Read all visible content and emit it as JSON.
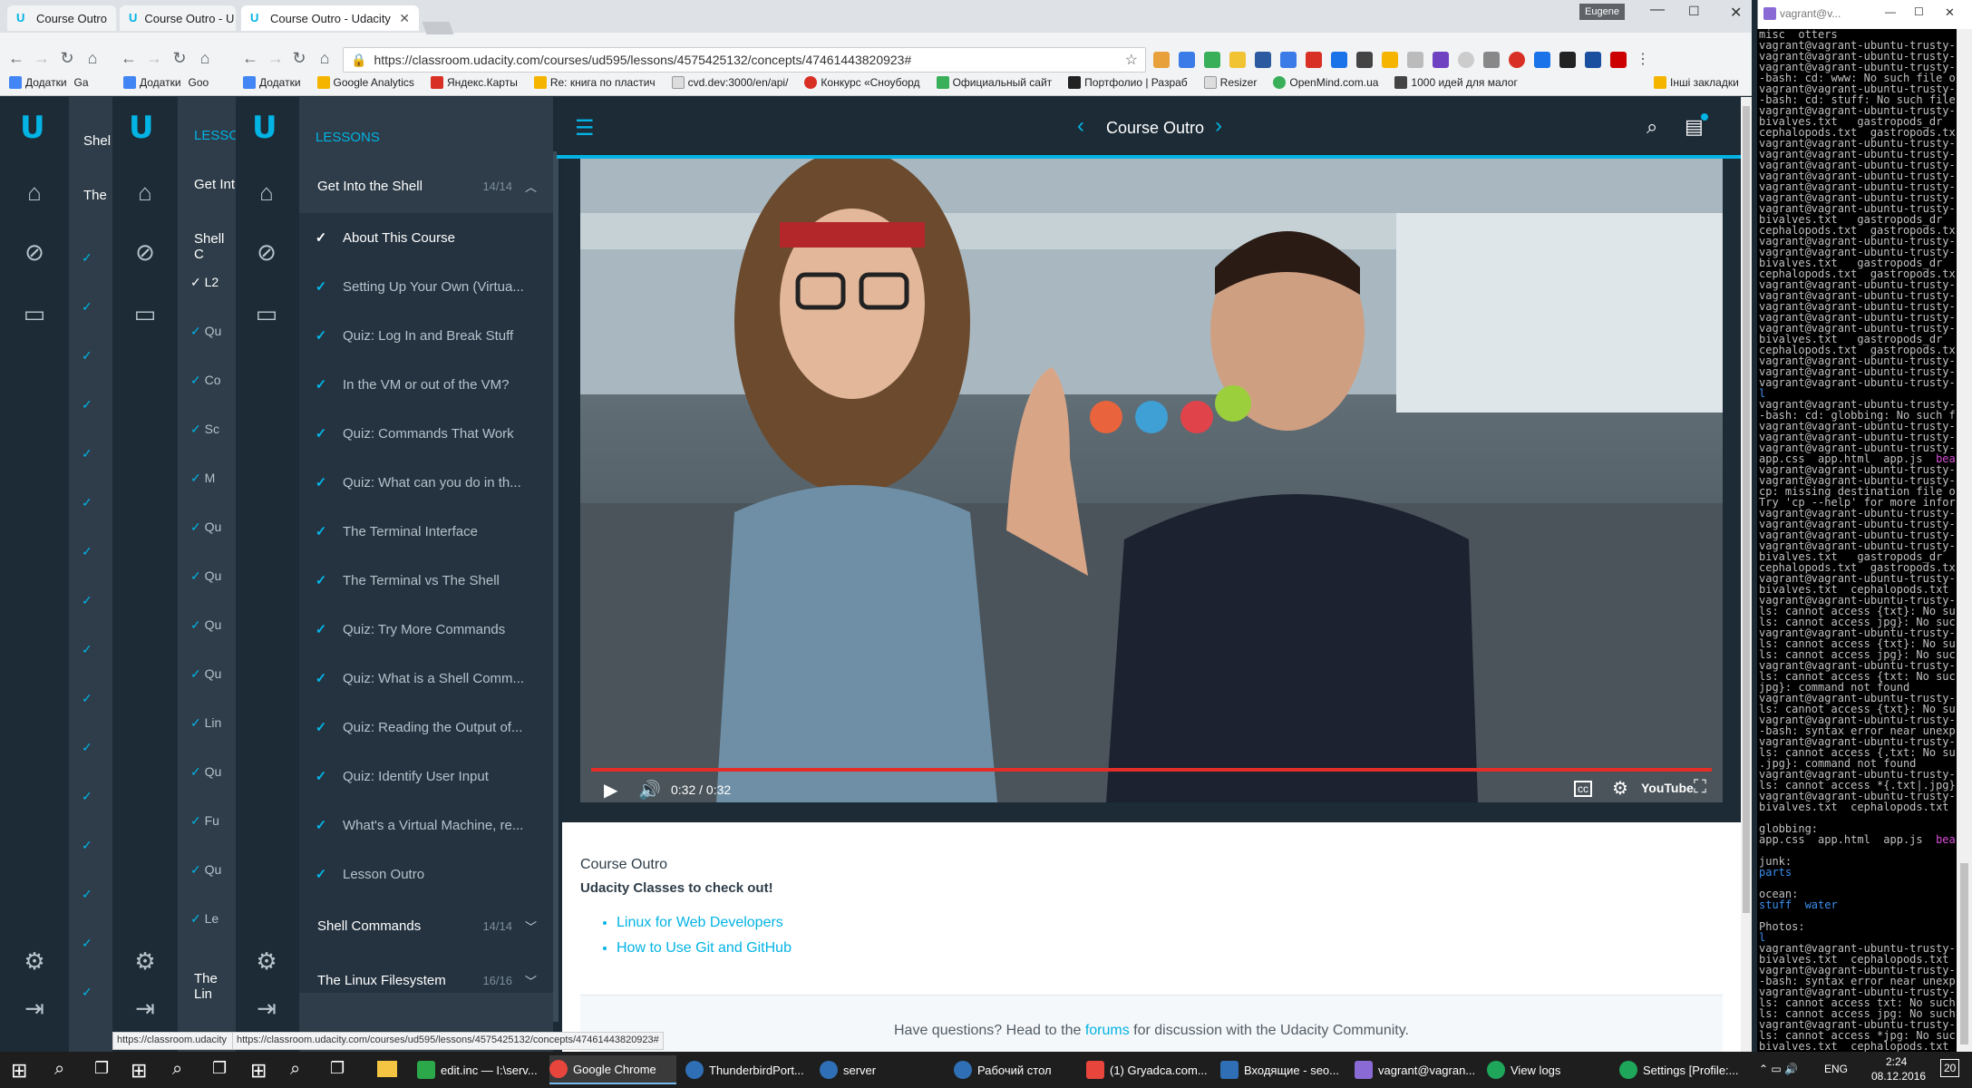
{
  "browser": {
    "tabs": [
      {
        "title": "Course Outro"
      },
      {
        "title": "Course Outro - U"
      },
      {
        "title": "Course Outro - Udacity"
      }
    ],
    "profile": "Eugene",
    "url": "https://classroom.udacity.com/courses/ud595/lessons/4575425132/concepts/47461443820923#",
    "bookmarks": [
      "Додатки",
      "Google Analytics",
      "Яндекс.Карты",
      "Re: книга по пластич",
      "cvd.dev:3000/en/api/",
      "Конкурс «Сноуборд",
      "Официальный сайт",
      "Портфолио | Разраб",
      "Resizer",
      "OpenMind.com.ua",
      "1000 идей для малог"
    ],
    "bookmarks_other": "Інші закладки",
    "bg_bookmarks": [
      "Додатки",
      "Ga",
      "Додатки",
      "Goo"
    ],
    "status_url": "https://classroom.udacity.com/courses/ud595/lessons/4575425132/concepts/47461443820923#",
    "status_url_short": "https://classroom.udacity"
  },
  "udacity": {
    "lessons_label": "LESSONS",
    "lessons_label_short": "LESSO",
    "page_title": "Course Outro",
    "current_section": {
      "title": "Get Into the Shell",
      "count": "14/14"
    },
    "items": [
      {
        "label": "About This Course",
        "active": true
      },
      {
        "label": "Setting Up Your Own (Virtua..."
      },
      {
        "label": "Quiz: Log In and Break Stuff"
      },
      {
        "label": "In the VM or out of the VM?"
      },
      {
        "label": "Quiz: Commands That Work"
      },
      {
        "label": "Quiz: What can you do in th..."
      },
      {
        "label": "The Terminal Interface"
      },
      {
        "label": "The Terminal vs The Shell"
      },
      {
        "label": "Quiz: Try More Commands"
      },
      {
        "label": "Quiz: What is a Shell Comm..."
      },
      {
        "label": "Quiz: Reading the Output of..."
      },
      {
        "label": "Quiz: Identify User Input"
      },
      {
        "label": "What's a Virtual Machine, re..."
      },
      {
        "label": "Lesson Outro"
      }
    ],
    "sections": [
      {
        "title": "Shell Commands",
        "count": "14/14"
      },
      {
        "title": "The Linux Filesystem",
        "count": "16/16"
      }
    ],
    "bg_panel2": {
      "header": "Get Int",
      "section": "Shell C",
      "item_prefixes": [
        "L2",
        "Qu",
        "Co",
        "Sc",
        "M",
        "Qu",
        "Qu",
        "Qu",
        "Qu",
        "Lin",
        "Qu",
        "Fu",
        "Qu",
        "Le"
      ],
      "footer": "The Lin"
    },
    "bg_panel1": {
      "items": [
        "Shel",
        "The"
      ]
    },
    "video": {
      "time": "0:32 / 0:32",
      "progress": 1.0
    },
    "content": {
      "heading": "Course Outro",
      "subheading": "Udacity Classes to check out!",
      "links": [
        "Linux for Web Developers",
        "How to Use Git and GitHub"
      ],
      "footer_prefix": "Have questions? Head to the ",
      "footer_link": "forums",
      "footer_suffix": " for discussion with the Udacity Community."
    }
  },
  "terminal": {
    "title": "vagrant@v...",
    "lines": [
      "misc  otters",
      "vagrant@vagrant-ubuntu-trusty-",
      "vagrant@vagrant-ubuntu-trusty-",
      "vagrant@vagrant-ubuntu-trusty-",
      "-bash: cd: www: No such file o",
      "vagrant@vagrant-ubuntu-trusty-",
      "-bash: cd: stuff: No such file",
      "vagrant@vagrant-ubuntu-trusty-",
      "bivalves.txt   gastropods_dr",
      "cephalopods.txt  gastropods.tx",
      "vagrant@vagrant-ubuntu-trusty-",
      "vagrant@vagrant-ubuntu-trusty-",
      "vagrant@vagrant-ubuntu-trusty-",
      "vagrant@vagrant-ubuntu-trusty-",
      "vagrant@vagrant-ubuntu-trusty-",
      "vagrant@vagrant-ubuntu-trusty-",
      "vagrant@vagrant-ubuntu-trusty-",
      "bivalves.txt   gastropods_dr",
      "cephalopods.txt  gastropods.tx",
      "vagrant@vagrant-ubuntu-trusty-",
      "vagrant@vagrant-ubuntu-trusty-",
      "bivalves.txt   gastropods_dr",
      "cephalopods.txt  gastropods.tx",
      "vagrant@vagrant-ubuntu-trusty-",
      "vagrant@vagrant-ubuntu-trusty-",
      "vagrant@vagrant-ubuntu-trusty-",
      "vagrant@vagrant-ubuntu-trusty-",
      "vagrant@vagrant-ubuntu-trusty-",
      "bivalves.txt   gastropods_dr",
      "cephalopods.txt  gastropods.tx",
      "vagrant@vagrant-ubuntu-trusty-",
      "vagrant@vagrant-ubuntu-trusty-",
      "vagrant@vagrant-ubuntu-trusty-",
      "l",
      "vagrant@vagrant-ubuntu-trusty-",
      "-bash: cd: globbing: No such f",
      "vagrant@vagrant-ubuntu-trusty-",
      "vagrant@vagrant-ubuntu-trusty-",
      "vagrant@vagrant-ubuntu-trusty-",
      "app.css  app.html  app.js  bea",
      "vagrant@vagrant-ubuntu-trusty-",
      "vagrant@vagrant-ubuntu-trusty-",
      "cp: missing destination file o",
      "Try 'cp --help' for more infor",
      "vagrant@vagrant-ubuntu-trusty-",
      "vagrant@vagrant-ubuntu-trusty-",
      "vagrant@vagrant-ubuntu-trusty-",
      "vagrant@vagrant-ubuntu-trusty-",
      "bivalves.txt   gastropods_dr",
      "cephalopods.txt  gastropods.tx",
      "vagrant@vagrant-ubuntu-trusty-",
      "bivalves.txt  cephalopods.txt",
      "vagrant@vagrant-ubuntu-trusty-",
      "ls: cannot access {txt}: No su",
      "ls: cannot access jpg}: No suc",
      "vagrant@vagrant-ubuntu-trusty-",
      "ls: cannot access {txt}: No su",
      "ls: cannot access jpg}: No suc",
      "vagrant@vagrant-ubuntu-trusty-",
      "ls: cannot access {txt: No suc",
      "jpg}: command not found",
      "vagrant@vagrant-ubuntu-trusty-",
      "ls: cannot access {txt}: No su",
      "vagrant@vagrant-ubuntu-trusty-",
      "-bash: syntax error near unexp",
      "vagrant@vagrant-ubuntu-trusty-",
      "ls: cannot access {.txt: No su",
      ".jpg}: command not found",
      "vagrant@vagrant-ubuntu-trusty-",
      "ls: cannot access *{.txt|.jpg}",
      "vagrant@vagrant-ubuntu-trusty-",
      "bivalves.txt  cephalopods.txt",
      "",
      "globbing:",
      "app.css  app.html  app.js  bea",
      "",
      "junk:",
      "parts",
      "",
      "ocean:",
      "stuff  water",
      "",
      "Photos:",
      "l",
      "vagrant@vagrant-ubuntu-trusty-",
      "bivalves.txt  cephalopods.txt",
      "vagrant@vagrant-ubuntu-trusty-",
      "-bash: syntax error near unexp",
      "vagrant@vagrant-ubuntu-trusty-",
      "ls: cannot access txt: No such",
      "ls: cannot access jpg: No such",
      "vagrant@vagrant-ubuntu-trusty-",
      "ls: cannot access *jpg: No suc",
      "bivalves.txt  cephalopods.txt",
      "vagrant@vagrant-ubuntu-trusty-"
    ]
  },
  "taskbar": {
    "items": [
      {
        "label": "edit.inc — I:\\serv...",
        "color": "#2aa84a"
      },
      {
        "label": "Google Chrome",
        "color": "#e8453c",
        "active": true
      },
      {
        "label": "ThunderbirdPort...",
        "color": "#2f6fb5"
      },
      {
        "label": "server",
        "color": "#2f6fb5"
      },
      {
        "label": "Рабочий стол",
        "color": "#2f6fb5"
      },
      {
        "label": "(1) Gryadca.com...",
        "color": "#e8453c"
      },
      {
        "label": "Входящие - seo...",
        "color": "#2f6fb5"
      },
      {
        "label": "vagrant@vagran...",
        "color": "#8a6bd6"
      },
      {
        "label": "View logs",
        "color": "#1ea65a"
      },
      {
        "label": "Settings [Profile:...",
        "color": "#1ea65a"
      }
    ],
    "tray": {
      "lang": "ENG",
      "time": "2:24",
      "date": "08.12.2016",
      "notifications": "20"
    }
  },
  "colors": {
    "accent": "#02b3e4",
    "sidebar": "#2e3d49",
    "rail": "#1c2b36",
    "progress": "#e52d27"
  }
}
